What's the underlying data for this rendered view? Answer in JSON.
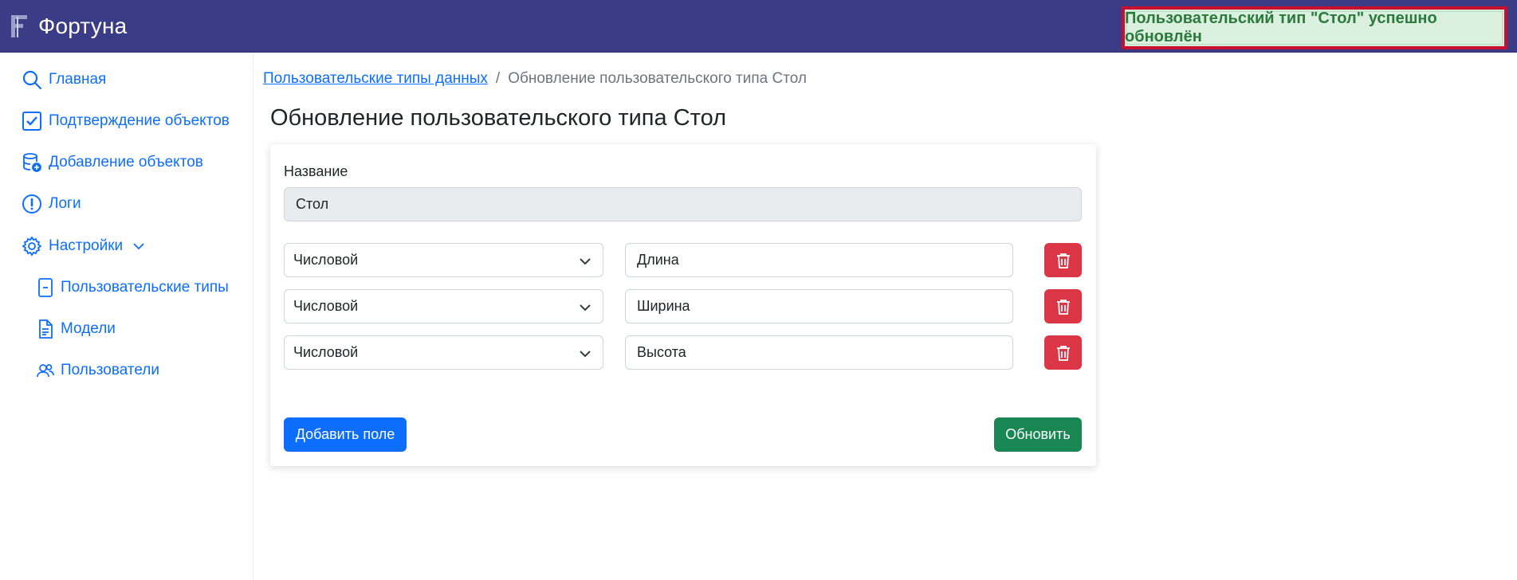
{
  "app": {
    "title": "Фортуна"
  },
  "toast": {
    "message": "Пользовательский тип \"Стол\" успешно обновлён"
  },
  "sidebar": {
    "items": [
      {
        "label": "Главная",
        "icon": "search-icon"
      },
      {
        "label": "Подтверждение объектов",
        "icon": "check-square-icon"
      },
      {
        "label": "Добавление объектов",
        "icon": "database-add-icon"
      },
      {
        "label": "Логи",
        "icon": "exclamation-circle-icon"
      },
      {
        "label": "Настройки",
        "icon": "gear-icon",
        "expanded": true
      }
    ],
    "subitems": [
      {
        "label": "Пользовательские типы",
        "icon": "file-minus-icon"
      },
      {
        "label": "Модели",
        "icon": "file-text-icon"
      },
      {
        "label": "Пользователи",
        "icon": "people-icon"
      }
    ]
  },
  "breadcrumb": {
    "link": "Пользовательские типы данных",
    "separator": "/",
    "current": "Обновление пользовательского типа Стол"
  },
  "page": {
    "title": "Обновление пользовательского типа Стол"
  },
  "form": {
    "name_label": "Название",
    "name_value": "Стол",
    "fields": [
      {
        "type": "Числовой",
        "name": "Длина"
      },
      {
        "type": "Числовой",
        "name": "Ширина"
      },
      {
        "type": "Числовой",
        "name": "Высота"
      }
    ],
    "add_button": "Добавить поле",
    "update_button": "Обновить"
  },
  "colors": {
    "topbar": "#3b3c87",
    "accent": "#0d6efd",
    "danger": "#dc3545",
    "success": "#198754",
    "toast_bg": "#d4edda",
    "toast_text": "#2a7a3b"
  }
}
